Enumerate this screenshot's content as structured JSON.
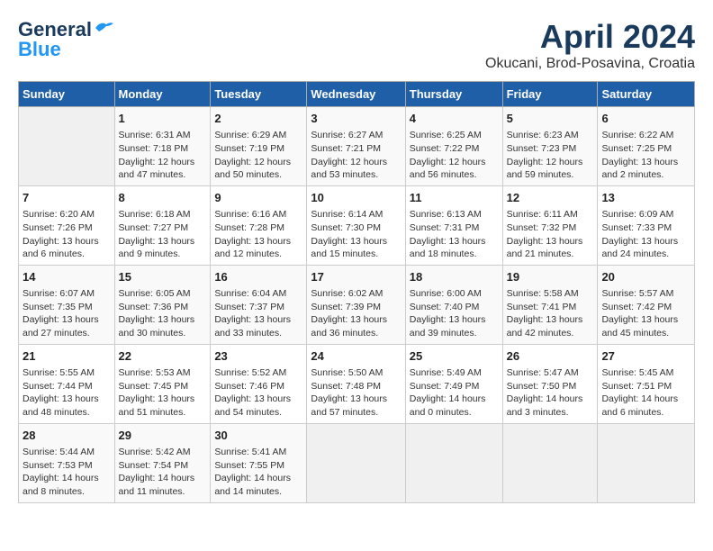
{
  "logo": {
    "line1": "General",
    "line2": "Blue"
  },
  "title": "April 2024",
  "subtitle": "Okucani, Brod-Posavina, Croatia",
  "days_of_week": [
    "Sunday",
    "Monday",
    "Tuesday",
    "Wednesday",
    "Thursday",
    "Friday",
    "Saturday"
  ],
  "weeks": [
    [
      {
        "day": "",
        "content": ""
      },
      {
        "day": "1",
        "content": "Sunrise: 6:31 AM\nSunset: 7:18 PM\nDaylight: 12 hours\nand 47 minutes."
      },
      {
        "day": "2",
        "content": "Sunrise: 6:29 AM\nSunset: 7:19 PM\nDaylight: 12 hours\nand 50 minutes."
      },
      {
        "day": "3",
        "content": "Sunrise: 6:27 AM\nSunset: 7:21 PM\nDaylight: 12 hours\nand 53 minutes."
      },
      {
        "day": "4",
        "content": "Sunrise: 6:25 AM\nSunset: 7:22 PM\nDaylight: 12 hours\nand 56 minutes."
      },
      {
        "day": "5",
        "content": "Sunrise: 6:23 AM\nSunset: 7:23 PM\nDaylight: 12 hours\nand 59 minutes."
      },
      {
        "day": "6",
        "content": "Sunrise: 6:22 AM\nSunset: 7:25 PM\nDaylight: 13 hours\nand 2 minutes."
      }
    ],
    [
      {
        "day": "7",
        "content": "Sunrise: 6:20 AM\nSunset: 7:26 PM\nDaylight: 13 hours\nand 6 minutes."
      },
      {
        "day": "8",
        "content": "Sunrise: 6:18 AM\nSunset: 7:27 PM\nDaylight: 13 hours\nand 9 minutes."
      },
      {
        "day": "9",
        "content": "Sunrise: 6:16 AM\nSunset: 7:28 PM\nDaylight: 13 hours\nand 12 minutes."
      },
      {
        "day": "10",
        "content": "Sunrise: 6:14 AM\nSunset: 7:30 PM\nDaylight: 13 hours\nand 15 minutes."
      },
      {
        "day": "11",
        "content": "Sunrise: 6:13 AM\nSunset: 7:31 PM\nDaylight: 13 hours\nand 18 minutes."
      },
      {
        "day": "12",
        "content": "Sunrise: 6:11 AM\nSunset: 7:32 PM\nDaylight: 13 hours\nand 21 minutes."
      },
      {
        "day": "13",
        "content": "Sunrise: 6:09 AM\nSunset: 7:33 PM\nDaylight: 13 hours\nand 24 minutes."
      }
    ],
    [
      {
        "day": "14",
        "content": "Sunrise: 6:07 AM\nSunset: 7:35 PM\nDaylight: 13 hours\nand 27 minutes."
      },
      {
        "day": "15",
        "content": "Sunrise: 6:05 AM\nSunset: 7:36 PM\nDaylight: 13 hours\nand 30 minutes."
      },
      {
        "day": "16",
        "content": "Sunrise: 6:04 AM\nSunset: 7:37 PM\nDaylight: 13 hours\nand 33 minutes."
      },
      {
        "day": "17",
        "content": "Sunrise: 6:02 AM\nSunset: 7:39 PM\nDaylight: 13 hours\nand 36 minutes."
      },
      {
        "day": "18",
        "content": "Sunrise: 6:00 AM\nSunset: 7:40 PM\nDaylight: 13 hours\nand 39 minutes."
      },
      {
        "day": "19",
        "content": "Sunrise: 5:58 AM\nSunset: 7:41 PM\nDaylight: 13 hours\nand 42 minutes."
      },
      {
        "day": "20",
        "content": "Sunrise: 5:57 AM\nSunset: 7:42 PM\nDaylight: 13 hours\nand 45 minutes."
      }
    ],
    [
      {
        "day": "21",
        "content": "Sunrise: 5:55 AM\nSunset: 7:44 PM\nDaylight: 13 hours\nand 48 minutes."
      },
      {
        "day": "22",
        "content": "Sunrise: 5:53 AM\nSunset: 7:45 PM\nDaylight: 13 hours\nand 51 minutes."
      },
      {
        "day": "23",
        "content": "Sunrise: 5:52 AM\nSunset: 7:46 PM\nDaylight: 13 hours\nand 54 minutes."
      },
      {
        "day": "24",
        "content": "Sunrise: 5:50 AM\nSunset: 7:48 PM\nDaylight: 13 hours\nand 57 minutes."
      },
      {
        "day": "25",
        "content": "Sunrise: 5:49 AM\nSunset: 7:49 PM\nDaylight: 14 hours\nand 0 minutes."
      },
      {
        "day": "26",
        "content": "Sunrise: 5:47 AM\nSunset: 7:50 PM\nDaylight: 14 hours\nand 3 minutes."
      },
      {
        "day": "27",
        "content": "Sunrise: 5:45 AM\nSunset: 7:51 PM\nDaylight: 14 hours\nand 6 minutes."
      }
    ],
    [
      {
        "day": "28",
        "content": "Sunrise: 5:44 AM\nSunset: 7:53 PM\nDaylight: 14 hours\nand 8 minutes."
      },
      {
        "day": "29",
        "content": "Sunrise: 5:42 AM\nSunset: 7:54 PM\nDaylight: 14 hours\nand 11 minutes."
      },
      {
        "day": "30",
        "content": "Sunrise: 5:41 AM\nSunset: 7:55 PM\nDaylight: 14 hours\nand 14 minutes."
      },
      {
        "day": "",
        "content": ""
      },
      {
        "day": "",
        "content": ""
      },
      {
        "day": "",
        "content": ""
      },
      {
        "day": "",
        "content": ""
      }
    ]
  ]
}
